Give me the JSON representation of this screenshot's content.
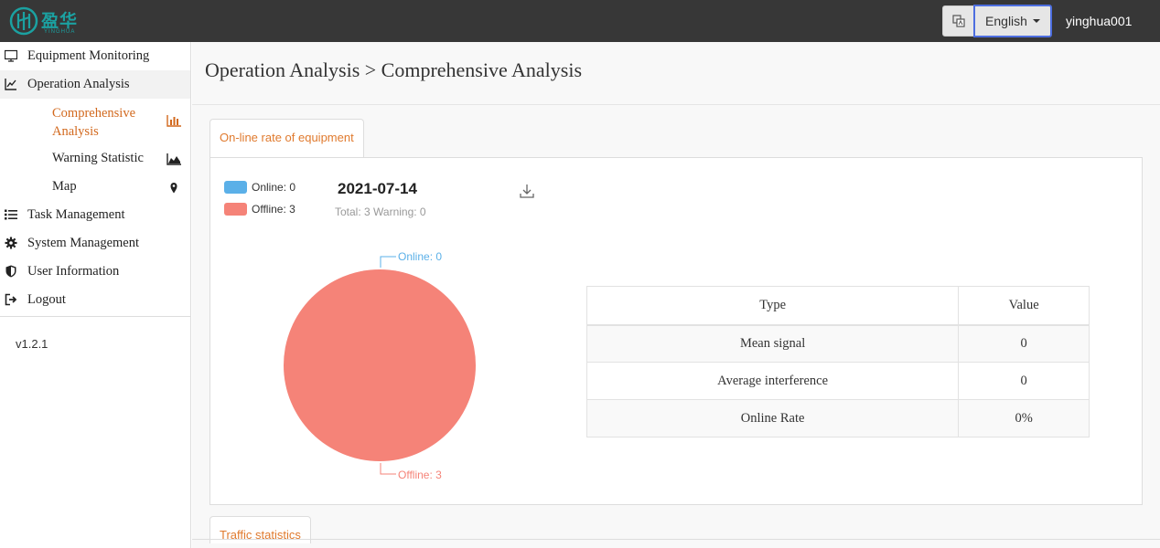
{
  "header": {
    "logo_text": "盈华",
    "logo_sub": "YINGHUA",
    "language": "English",
    "username": "yinghua001"
  },
  "sidebar": {
    "items": [
      {
        "label": "Equipment Monitoring",
        "icon": "monitor-icon"
      },
      {
        "label": "Operation Analysis",
        "icon": "line-chart-icon"
      },
      {
        "label": "Task Management",
        "icon": "list-icon"
      },
      {
        "label": "System Management",
        "icon": "gear-icon"
      },
      {
        "label": "User Information",
        "icon": "shield-icon"
      },
      {
        "label": "Logout",
        "icon": "logout-icon"
      }
    ],
    "subitems": [
      {
        "label": "Comprehensive Analysis",
        "icon": "bar-chart-icon"
      },
      {
        "label": "Warning Statistic",
        "icon": "area-chart-icon"
      },
      {
        "label": "Map",
        "icon": "map-pin-icon"
      }
    ],
    "version": "v1.2.1"
  },
  "main": {
    "breadcrumb": "Operation Analysis > Comprehensive Analysis",
    "tab1": "On-line rate of equipment",
    "tab2": "Traffic statistics",
    "legend": {
      "online": "Online: 0",
      "offline": "Offline: 3"
    },
    "date": "2021-07-14",
    "summary": "Total: 3 Warning: 0",
    "pie_labels": {
      "online": "Online: 0",
      "offline": "Offline: 3"
    },
    "table": {
      "headers": [
        "Type",
        "Value"
      ],
      "rows": [
        {
          "type": "Mean signal",
          "value": "0"
        },
        {
          "type": "Average interference",
          "value": "0"
        },
        {
          "type": "Online Rate",
          "value": "0%"
        }
      ]
    }
  },
  "colors": {
    "online": "#5bb0e8",
    "offline": "#f58378",
    "accent": "#d2691e",
    "topbar": "#373737"
  },
  "chart_data": {
    "type": "pie",
    "categories": [
      "Online",
      "Offline"
    ],
    "values": [
      0,
      3
    ],
    "title": "",
    "legend": "top-left"
  }
}
